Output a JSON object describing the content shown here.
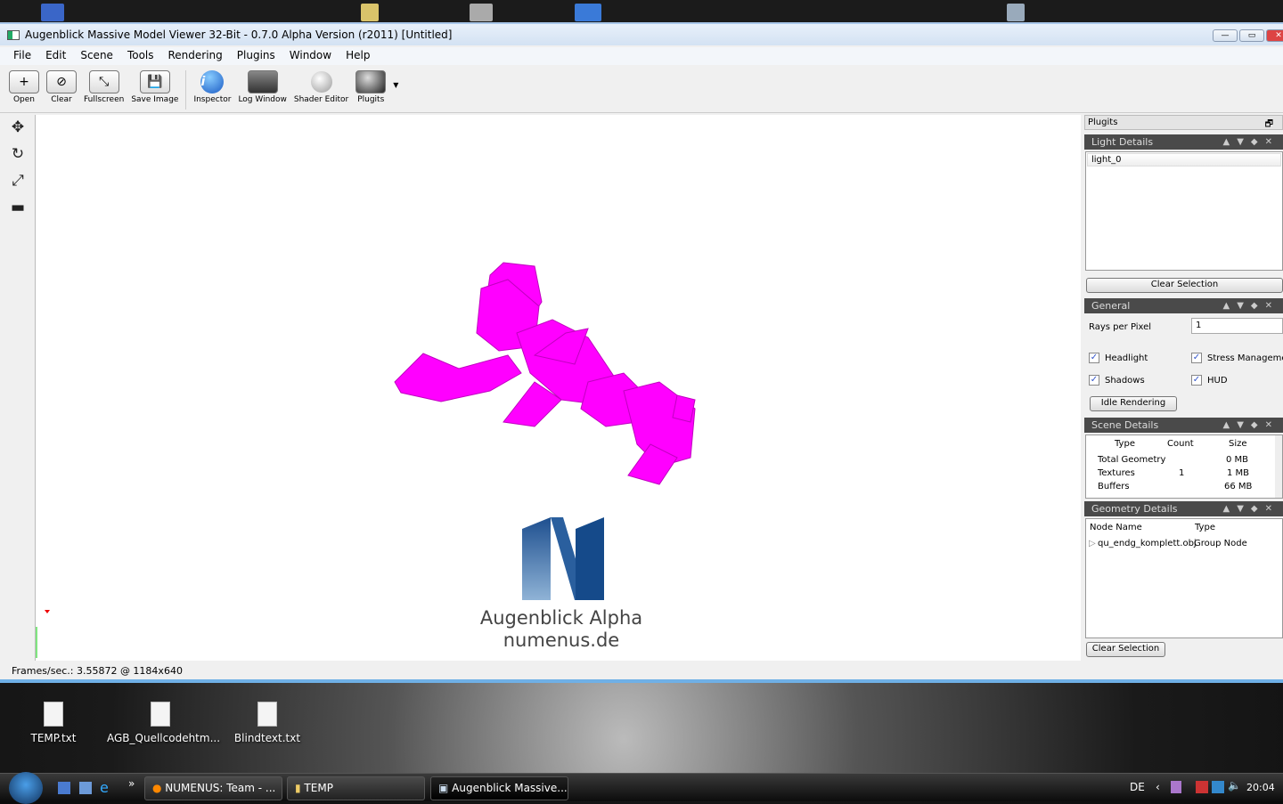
{
  "window": {
    "title": "Augenblick Massive Model Viewer 32-Bit - 0.7.0 Alpha Version (r2011) [Untitled]"
  },
  "menu": [
    "File",
    "Edit",
    "Scene",
    "Tools",
    "Rendering",
    "Plugins",
    "Window",
    "Help"
  ],
  "toolbar": [
    {
      "label": "Open",
      "icon": "plus-icon"
    },
    {
      "label": "Clear",
      "icon": "clear-icon"
    },
    {
      "label": "Fullscreen",
      "icon": "fullscreen-icon"
    },
    {
      "label": "Save Image",
      "icon": "floppy-icon"
    },
    {
      "label": "Inspector",
      "icon": "info-icon"
    },
    {
      "label": "Log Window",
      "icon": "window-icon"
    },
    {
      "label": "Shader Editor",
      "icon": "sphere-icon"
    },
    {
      "label": "Plugits",
      "icon": "plugits-icon"
    }
  ],
  "viewport": {
    "logo_line1": "Augenblick Alpha",
    "logo_line2": "numenus.de",
    "model_color": "#ff00ff"
  },
  "panel": {
    "title": "Plugits",
    "light": {
      "header": "Light Details",
      "items": [
        "light_0"
      ],
      "clear": "Clear Selection"
    },
    "general": {
      "header": "General",
      "rays_label": "Rays per Pixel",
      "rays_value": "1",
      "headlight": "Headlight",
      "stress": "Stress Management",
      "shadows": "Shadows",
      "hud": "HUD",
      "idle": "Idle Rendering"
    },
    "scene": {
      "header": "Scene Details",
      "cols": [
        "Type",
        "Count",
        "Size"
      ],
      "rows": [
        [
          "Total Geometry",
          "",
          "0 MB"
        ],
        [
          "Textures",
          "1",
          "1 MB"
        ],
        [
          "Buffers",
          "",
          "66 MB"
        ]
      ]
    },
    "geometry": {
      "header": "Geometry Details",
      "cols": [
        "Node Name",
        "Type"
      ],
      "rows": [
        [
          "qu_endg_komplett.obj",
          "Group Node"
        ]
      ],
      "clear": "Clear Selection"
    }
  },
  "status": "Frames/sec.: 3.55872 @ 1184x640",
  "desktop": [
    "TEMP.txt",
    "AGB_Quellcodehtm...",
    "Blindtext.txt"
  ],
  "taskbar": {
    "tasks": [
      "NUMENUS: Team - ...",
      "TEMP",
      "Augenblick Massive..."
    ],
    "lang": "DE",
    "clock": "20:04"
  }
}
